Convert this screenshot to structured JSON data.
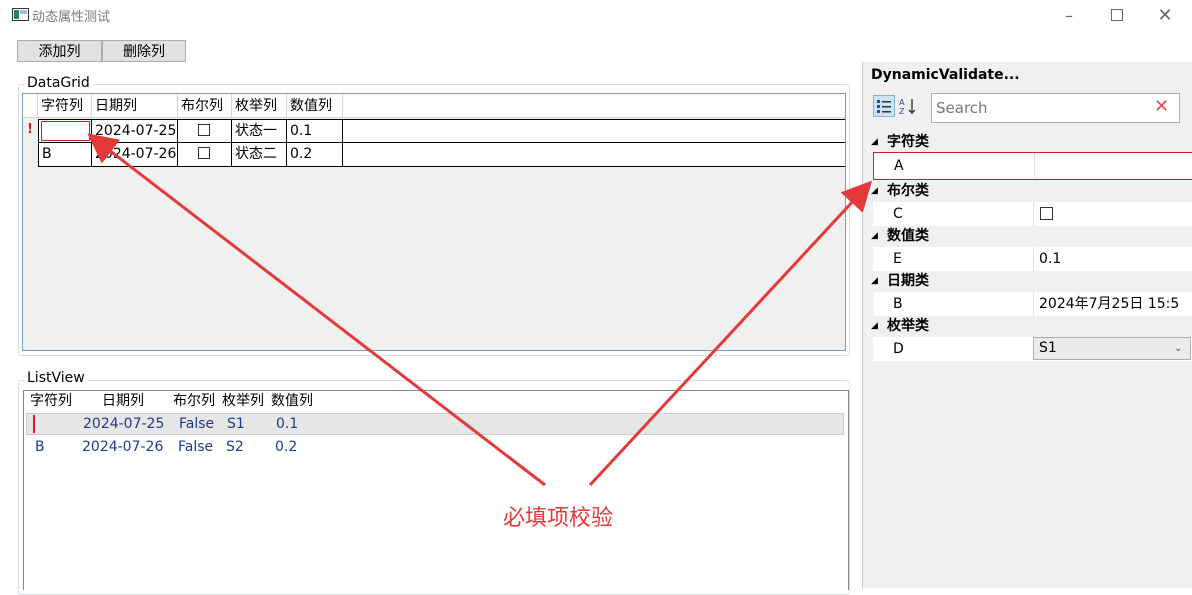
{
  "window": {
    "title": "动态属性测试"
  },
  "toolbar": {
    "add_column": "添加列",
    "remove_column": "删除列"
  },
  "datagrid": {
    "group_title": "DataGrid",
    "columns": [
      "字符列",
      "日期列",
      "布尔列",
      "枚举列",
      "数值列"
    ],
    "rows": [
      {
        "error_mark": "!",
        "text": "",
        "date": "2024-07-25",
        "bool": false,
        "enum": "状态一",
        "number": "0.1"
      },
      {
        "error_mark": "",
        "text": "B",
        "date": "2024-07-26",
        "bool": false,
        "enum": "状态二",
        "number": "0.2"
      }
    ]
  },
  "listview": {
    "group_title": "ListView",
    "columns": [
      "字符列",
      "日期列",
      "布尔列",
      "枚举列",
      "数值列"
    ],
    "rows": [
      {
        "text": "",
        "date": "2024-07-25",
        "bool": "False",
        "enum": "S1",
        "number": "0.1"
      },
      {
        "text": "B",
        "date": "2024-07-26",
        "bool": "False",
        "enum": "S2",
        "number": "0.2"
      }
    ]
  },
  "property_grid": {
    "title": "DynamicValidate...",
    "search_placeholder": "Search",
    "categories": [
      {
        "name": "字符类",
        "property": "A",
        "value": ""
      },
      {
        "name": "布尔类",
        "property": "C",
        "value": ""
      },
      {
        "name": "数值类",
        "property": "E",
        "value": "0.1"
      },
      {
        "name": "日期类",
        "property": "B",
        "value": "2024年7月25日 15:5"
      },
      {
        "name": "枚举类",
        "property": "D",
        "value": "S1"
      }
    ]
  },
  "annotation": {
    "text": "必填项校验"
  },
  "colors": {
    "annotation_red": "#e23a3a",
    "error_red": "#d02020",
    "grid_border": "#7a9cc0"
  }
}
